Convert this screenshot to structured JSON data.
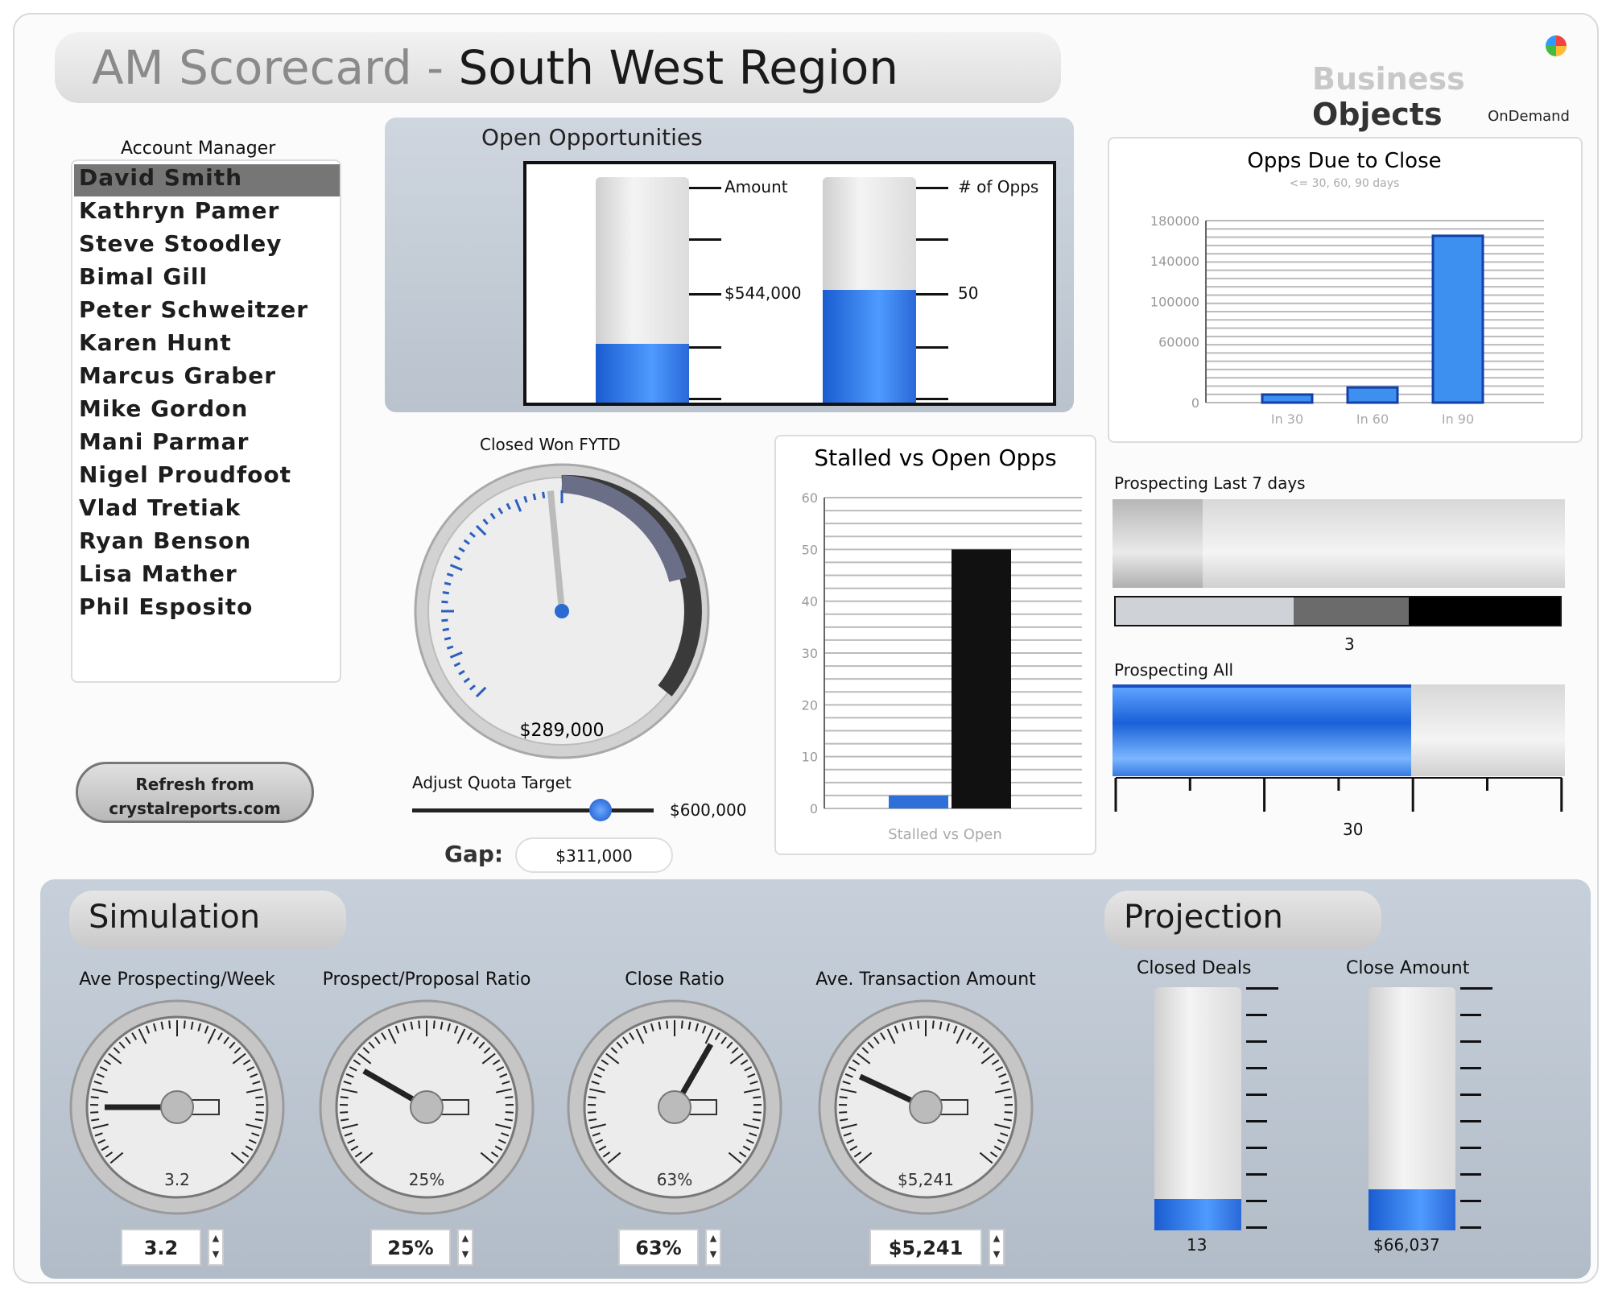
{
  "header": {
    "title_prefix": "AM Scorecard - ",
    "title_region": "South West Region",
    "logo_word1": "Business ",
    "logo_word2": "Objects",
    "logo_sub": "OnDemand"
  },
  "account_managers": {
    "label": "Account Manager",
    "items": [
      "David Smith",
      "Kathryn Pamer",
      "Steve Stoodley",
      "Bimal Gill",
      "Peter Schweitzer",
      "Karen Hunt",
      "Marcus Graber",
      "Mike Gordon",
      "Mani Parmar",
      "Nigel Proudfoot",
      "Vlad Tretiak",
      "Ryan Benson",
      "Lisa Mather",
      "Phil Esposito"
    ],
    "selected": "David Smith"
  },
  "refresh_button": {
    "line1": "Refresh from",
    "line2": "crystalreports.com"
  },
  "open_opportunities": {
    "title": "Open Opportunities",
    "amount_label": "Amount",
    "amount_tick": "$544,000",
    "amount_fill": 0.26,
    "count_label": "# of Opps",
    "count_tick": "50",
    "count_fill": 0.5
  },
  "closed_won": {
    "title": "Closed Won FYTD",
    "value": "$289,000",
    "slider_label": "Adjust Quota Target",
    "slider_value": "$600,000",
    "slider_position": 0.78,
    "gap_label": "Gap:",
    "gap_value": "$311,000",
    "needle_fraction": 0.48
  },
  "opps_due": {
    "chart_data": {
      "type": "bar",
      "title": "Opps Due to Close",
      "subtitle": "<= 30, 60, 90 days",
      "categories": [
        "In 30",
        "In 60",
        "In 90"
      ],
      "values": [
        8000,
        15000,
        165000
      ],
      "ylim": [
        0,
        180000
      ],
      "yticks": [
        "0",
        "60000",
        "100000",
        "140000",
        "180000"
      ]
    }
  },
  "stalled_vs_open": {
    "chart_data": {
      "type": "bar",
      "title": "Stalled vs Open Opps",
      "categories": [
        "Stalled vs Open"
      ],
      "series": [
        {
          "name": "Stalled",
          "values": [
            2.5
          ]
        },
        {
          "name": "Open",
          "values": [
            50
          ]
        }
      ],
      "ylim": [
        0,
        60
      ],
      "yticks": [
        "0",
        "10",
        "20",
        "30",
        "40",
        "50",
        "60"
      ]
    }
  },
  "prospecting_7": {
    "title": "Prospecting Last 7 days",
    "value": "3",
    "fill": 0.2
  },
  "prospecting_all": {
    "title": "Prospecting All",
    "value": "30",
    "fill": 0.66
  },
  "simulation": {
    "title": "Simulation",
    "gauges": [
      {
        "label": "Ave Prospecting/Week",
        "value": "3.2",
        "needle_angle": -90
      },
      {
        "label": "Prospect/Proposal Ratio",
        "value": "25%",
        "needle_angle": -60
      },
      {
        "label": "Close Ratio",
        "value": "63%",
        "needle_angle": 30
      },
      {
        "label": "Ave. Transaction Amount",
        "value": "$5,241",
        "needle_angle": -65
      }
    ]
  },
  "projection": {
    "title": "Projection",
    "closed_deals": {
      "label": "Closed Deals",
      "value": "13",
      "fill": 0.13
    },
    "close_amount": {
      "label": "Close Amount",
      "value": "$66,037",
      "fill": 0.17
    }
  }
}
